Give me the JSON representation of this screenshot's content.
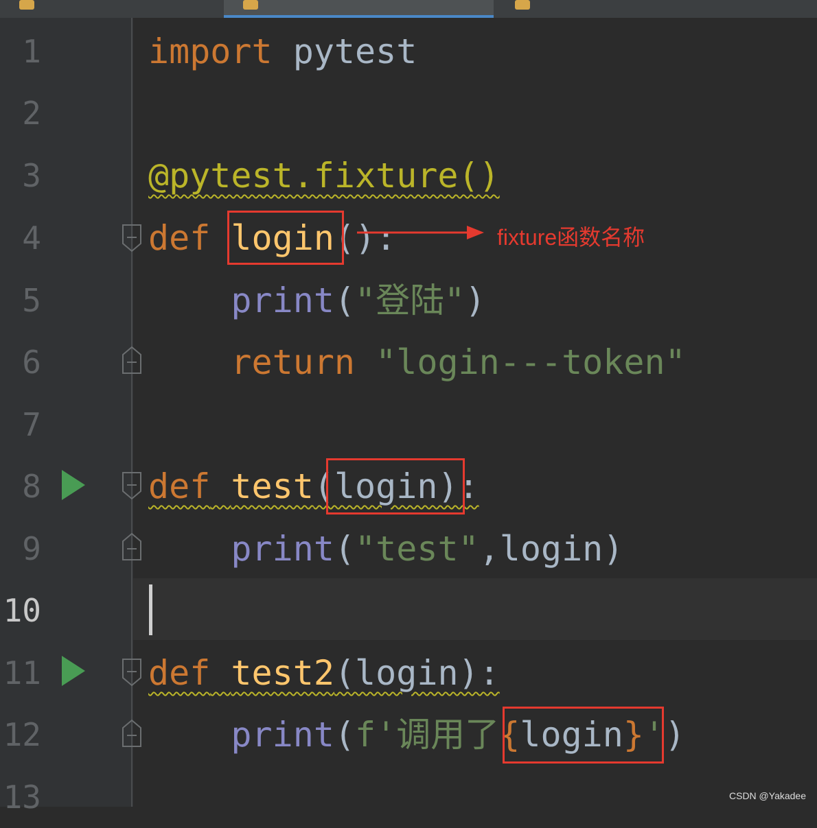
{
  "tabs": [
    {
      "label": "",
      "active": false
    },
    {
      "label": "",
      "active": true
    },
    {
      "label": "",
      "active": false
    }
  ],
  "line_numbers": [
    "1",
    "2",
    "3",
    "4",
    "5",
    "6",
    "7",
    "8",
    "9",
    "10",
    "11",
    "12",
    "13"
  ],
  "code": {
    "l1": {
      "kw": "import",
      "mod": " pytest"
    },
    "l3": {
      "decorator": "@pytest.fixture()"
    },
    "l4": {
      "kw": "def",
      "name": "login",
      "rest": "():"
    },
    "l5": {
      "indent": "    ",
      "fn": "print",
      "open": "(",
      "str": "\"登陆\"",
      "close": ")"
    },
    "l6": {
      "indent": "    ",
      "kw": "return",
      "str": " \"login---token\""
    },
    "l8": {
      "kw": "def",
      "sp": " ",
      "name": "test",
      "rest": "(login):"
    },
    "l9": {
      "indent": "    ",
      "fn": "print",
      "open": "(",
      "str": "\"test\"",
      "rest": ",login)"
    },
    "l11": {
      "kw": "def",
      "sp": " ",
      "name": "test2",
      "rest": "(login):"
    },
    "l12": {
      "indent": "    ",
      "fn": "print",
      "open": "(",
      "str1": "f'调用了",
      "brace_open": "{",
      "var": "login",
      "brace_close": "}",
      "str2": "'",
      "close": ")"
    }
  },
  "annotation": {
    "text": "fixture函数名称",
    "color": "#e53a2f"
  },
  "watermark": "CSDN @Yakadee",
  "colors": {
    "background": "#2b2b2b",
    "keyword": "#cc7832",
    "decorator": "#bbb529",
    "function_name": "#ffc66d",
    "builtin": "#8888c6",
    "string": "#6a8759",
    "run_icon": "#499c54",
    "highlight_box": "#e53a2f"
  },
  "icons": [
    "run-gutter-icon",
    "fold-icon",
    "python-file-icon"
  ]
}
